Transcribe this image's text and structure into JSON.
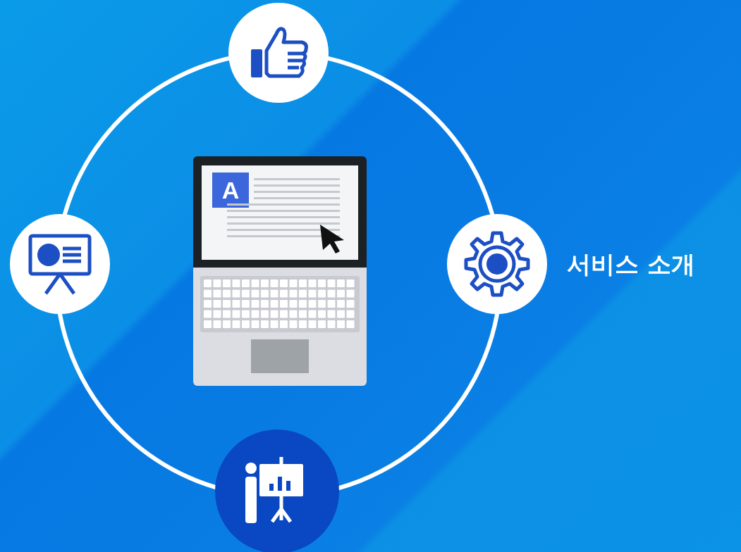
{
  "laptop": {
    "screen_letter": "A"
  },
  "nodes": [
    {
      "kind": "thumb",
      "selected": false
    },
    {
      "kind": "board",
      "selected": false
    },
    {
      "kind": "gear",
      "selected": false,
      "label": "서비스 소개"
    },
    {
      "kind": "presenter",
      "selected": true
    }
  ]
}
